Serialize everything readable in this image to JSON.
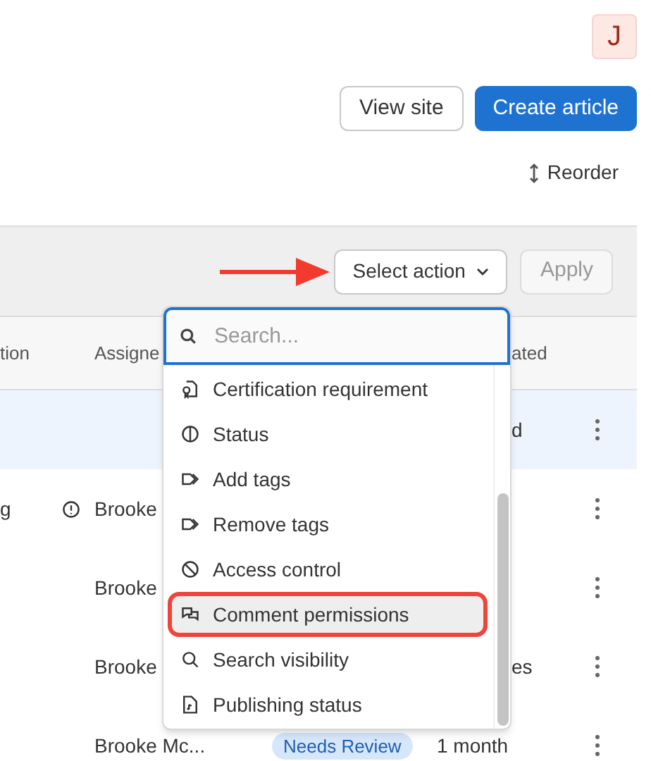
{
  "avatar": {
    "initial": "J"
  },
  "header_buttons": [
    {
      "label": "View site",
      "kind": "secondary"
    },
    {
      "label": "Create article",
      "kind": "primary"
    }
  ],
  "reorder": {
    "label": "Reorder"
  },
  "bulk_bar": {
    "select": {
      "label": "Select action"
    },
    "apply": {
      "label": "Apply",
      "disabled": true
    },
    "arrow_annotation": true
  },
  "table": {
    "columns": [
      "tion",
      "Assigne",
      "ated"
    ],
    "rows": [
      {
        "selected": true,
        "column_3": "d"
      },
      {
        "selected": false,
        "column_1": "g",
        "warning": true,
        "assignee": "Brooke"
      },
      {
        "selected": false,
        "assignee": "Brooke"
      },
      {
        "selected": false,
        "assignee": "Brooke",
        "column_3": "es"
      },
      {
        "selected": false,
        "assignee": "Brooke Mc...",
        "status": "Needs Review",
        "updated": "1 month"
      }
    ]
  },
  "dropdown": {
    "search": {
      "placeholder": "Search..."
    },
    "items": [
      {
        "label": "Certification requirement",
        "kind": "certificate",
        "highlighted": false,
        "callout": false
      },
      {
        "label": "Status",
        "kind": "status",
        "highlighted": false,
        "callout": false
      },
      {
        "label": "Add tags",
        "kind": "tag",
        "highlighted": false,
        "callout": false
      },
      {
        "label": "Remove tags",
        "kind": "tag",
        "highlighted": false,
        "callout": false
      },
      {
        "label": "Access control",
        "kind": "ban",
        "highlighted": false,
        "callout": false
      },
      {
        "label": "Comment permissions",
        "kind": "comments",
        "highlighted": true,
        "callout": true
      },
      {
        "label": "Search visibility",
        "kind": "search",
        "highlighted": false,
        "callout": false
      },
      {
        "label": "Publishing status",
        "kind": "file",
        "highlighted": false,
        "callout": false
      }
    ]
  }
}
